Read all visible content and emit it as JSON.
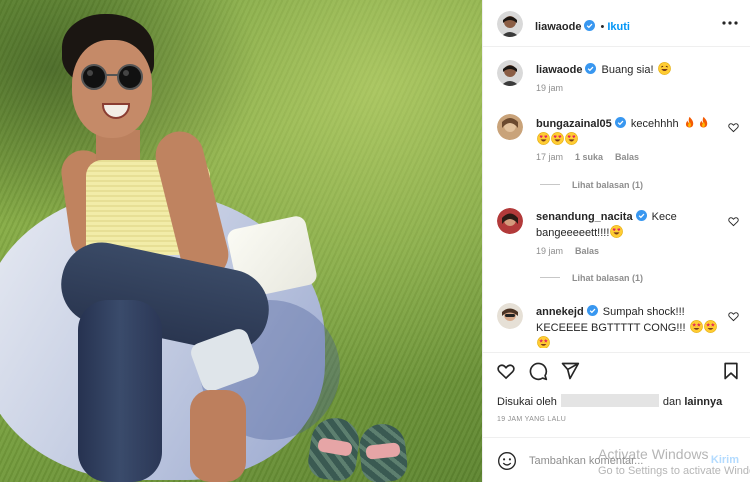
{
  "post": {
    "author": "liawaode",
    "follow_label": "Ikuti",
    "more_icon": "more-horizontal-icon",
    "caption": {
      "username": "liawaode",
      "text": "Buang sia!",
      "emoji": "grinning-face-emoji",
      "time": "19 jam"
    }
  },
  "comments": [
    {
      "username": "bungazainal05",
      "text": "kecehhhh",
      "emojis": [
        "fire",
        "fire",
        "heart-eyes",
        "heart-eyes",
        "heart-eyes"
      ],
      "time": "17 jam",
      "likes": "1 suka",
      "reply_label": "Balas",
      "view_replies": "Lihat balasan (1)"
    },
    {
      "username": "senandung_nacita",
      "text_line1": "Kece",
      "text_line2": "bangeeeeett!!!!",
      "emojis": [
        "heart-eyes"
      ],
      "time": "19 jam",
      "reply_label": "Balas",
      "view_replies": "Lihat balasan (1)"
    },
    {
      "username": "annekejd",
      "text_line1": "Sumpah shock!!!",
      "text_line2": "KECEEEE BGTTTTT CONG!!!",
      "emojis": [
        "star-struck",
        "star-struck",
        "star-struck"
      ]
    }
  ],
  "actions": {
    "like_icon": "heart-icon",
    "comment_icon": "comment-icon",
    "share_icon": "send-icon",
    "save_icon": "bookmark-icon"
  },
  "likes": {
    "prefix": "Disukai oleh",
    "joiner": "dan",
    "suffix": "lainnya"
  },
  "timestamp": "19 JAM YANG LALU",
  "add_comment": {
    "placeholder": "Tambahkan komentar...",
    "post_label": "Kirim"
  },
  "watermark": {
    "line1": "Activate Windows",
    "line2": "Go to Settings to activate Windows."
  },
  "colors": {
    "link_blue": "#0095f6",
    "verified_blue": "#3897f0",
    "muted": "#8e8e8e",
    "text": "#262626",
    "post_disabled": "#b3dbff"
  }
}
